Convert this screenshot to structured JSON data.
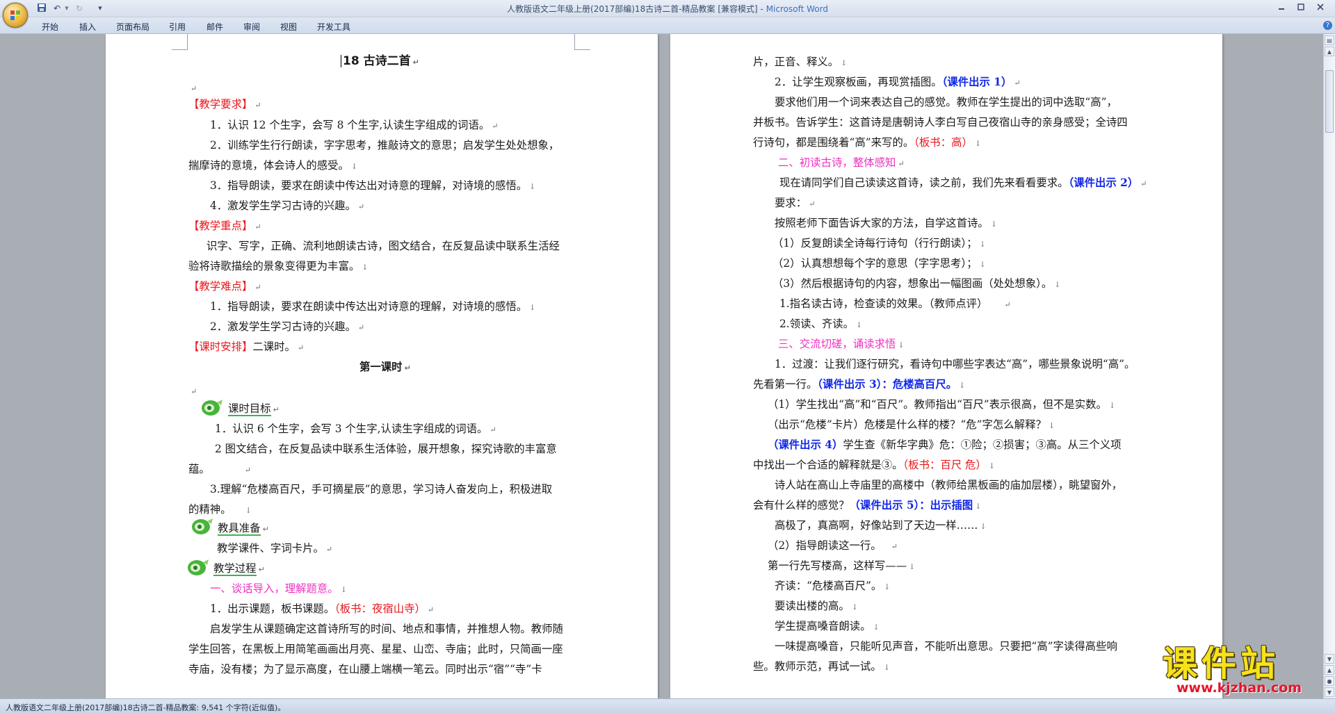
{
  "window": {
    "title": "人教版语文二年级上册(2017部编)18古诗二首-精品教案 [兼容模式]",
    "title_sep": " - ",
    "app_name": "Microsoft Word"
  },
  "quick_access": {
    "dropdown": "▼"
  },
  "ribbon": {
    "tabs": [
      "开始",
      "插入",
      "页面布局",
      "引用",
      "邮件",
      "审阅",
      "视图",
      "开发工具"
    ],
    "help": "?"
  },
  "page1": {
    "title": "18  古诗二首",
    "teaching_req_h": "【教学要求】",
    "req1": "1．认识 12 个生字，会写 8 个生字,认读生字组成的词语。",
    "req2a": "2．训练学生行行朗读，字字思考，推敲诗文的意思；启发学生处处想象，",
    "req2b": "揣摩诗的意境，体会诗人的感受。",
    "req3": "3．指导朗读，要求在朗读中传达出对诗意的理解，对诗境的感悟。",
    "req4": "4．激发学生学习古诗的兴趣。",
    "focus_h": "【教学重点】",
    "focus_a": "识字、写字，正确、流利地朗读古诗，图文结合，在反复品读中联系生活经",
    "focus_b": "验将诗歌描绘的景象变得更为丰富。",
    "diff_h": "【教学难点】",
    "diff1": "1．指导朗读，要求在朗读中传达出对诗意的理解，对诗境的感悟。",
    "diff2": "2．激发学生学习古诗的兴趣。",
    "time_h": "【课时安排】",
    "time_v": "二课时。",
    "lesson1": "第一课时",
    "goal_h": "课时目标",
    "goal1": "1．认识 6 个生字，会写 3 个生字,认读生字组成的词语。",
    "goal2a": "2 图文结合，在反复品读中联系生活体验，展开想象，探究诗歌的丰富意",
    "goal2b": "蕴。",
    "goal3a": "3.理解“危楼高百尺，手可摘星辰”的意思，学习诗人奋发向上，积极进取",
    "goal3b": "的精神。",
    "prep_h": "教具准备",
    "prep_v": "教学课件、字词卡片。",
    "proc_h": "教学过程",
    "sec1": "一、谈话导入，理解题意。",
    "step1": "1．出示课题，板书课题。",
    "step1_board": "（板书：夜宿山寺）",
    "para_a": "启发学生从课题确定这首诗所写的时间、地点和事情，并推想人物。教师随",
    "para_b": "学生回答，在黑板上用简笔画画出月亮、星星、山峦、寺庙；此时，只简画一座",
    "para_c": "寺庙，没有楼；为了显示高度，在山腰上端横一笔云。同时出示“宿”“寺”卡"
  },
  "page2": {
    "l1": "片，正音、释义。",
    "l2": "2．让学生观察板画，再现赏插图。",
    "l2_blue": "（课件出示 1）",
    "l3": "要求他们用一个词来表达自己的感觉。教师在学生提出的词中选取“高”，",
    "l4": "并板书。告诉学生：这首诗是唐朝诗人李白写自己夜宿山寺的亲身感受；全诗四",
    "l5": "行诗句，都是围绕着“高”来写的。",
    "l5_red": "（板书：高）",
    "sec2": "二、初读古诗，整体感知",
    "l6": "现在请同学们自己读读这首诗，读之前，我们先来看看要求。",
    "l6_blue": "（课件出示 2）",
    "l7": "要求：",
    "l8": "按照老师下面告诉大家的方法，自学这首诗。",
    "l9": "（1）反复朗读全诗每行诗句（行行朗读）；",
    "l10": "（2）认真想想每个字的意思（字字思考）；",
    "l11": "（3）然后根据诗句的内容，想象出一幅图画（处处想象）。",
    "l12": "1.指名读古诗，检查读的效果。（教师点评）",
    "l13": "2.领读、齐读。",
    "sec3": "三、交流切磋，诵读求悟",
    "l14": "1．过渡：让我们逐行研究，看诗句中哪些字表达“高”，哪些景象说明“高”。",
    "l15": "先看第一行。",
    "l15_blue": "（课件出示 3）：危楼高百尺。",
    "l16": "（1）学生找出“高”和“百尺”。教师指出“百尺”表示很高，但不是实数。",
    "l17": "（出示“危楼”卡片）危楼是什么样的楼？“危”字怎么解释？",
    "l18_blue": "（课件出示 4）",
    "l18": "学生查《新华字典》危：①险；②损害；③高。从三个义项",
    "l19": "中找出一个合适的解释就是③。",
    "l19_red": "（板书：百尺 危）",
    "l20": "诗人站在高山上寺庙里的高楼中（教师给黑板画的庙加层楼），眺望窗外，",
    "l21": "会有什么样的感觉？",
    "l21_blue": "（课件出示 5）：出示插图",
    "l22": "高极了，真高啊，好像站到了天边一样……",
    "l23": "（2）指导朗读这一行。",
    "l24": "第一行先写楼高，这样写——",
    "l25": "齐读：“危楼高百尺”。",
    "l26": "要读出楼的高。",
    "l27": "学生提高嗓音朗读。",
    "l28": "一味提高嗓音，只能听见声音，不能听出意思。只要把“高”字读得高些响",
    "l29": "些。教师示范，再试一试。"
  },
  "status": {
    "text": "人教版语文二年级上册(2017部编)18古诗二首-精品教案: 9,541 个字符(近似值)。"
  },
  "watermark": {
    "main": "课件站",
    "url": "www.kjzhan.com"
  },
  "marks": {
    "para": "↵",
    "down": "↓"
  },
  "colors": {
    "heading_red": "#e8161b",
    "section_pink": "#f02fc2",
    "courseware_blue": "#1027e8",
    "app_blue": "#3a6ec2"
  }
}
